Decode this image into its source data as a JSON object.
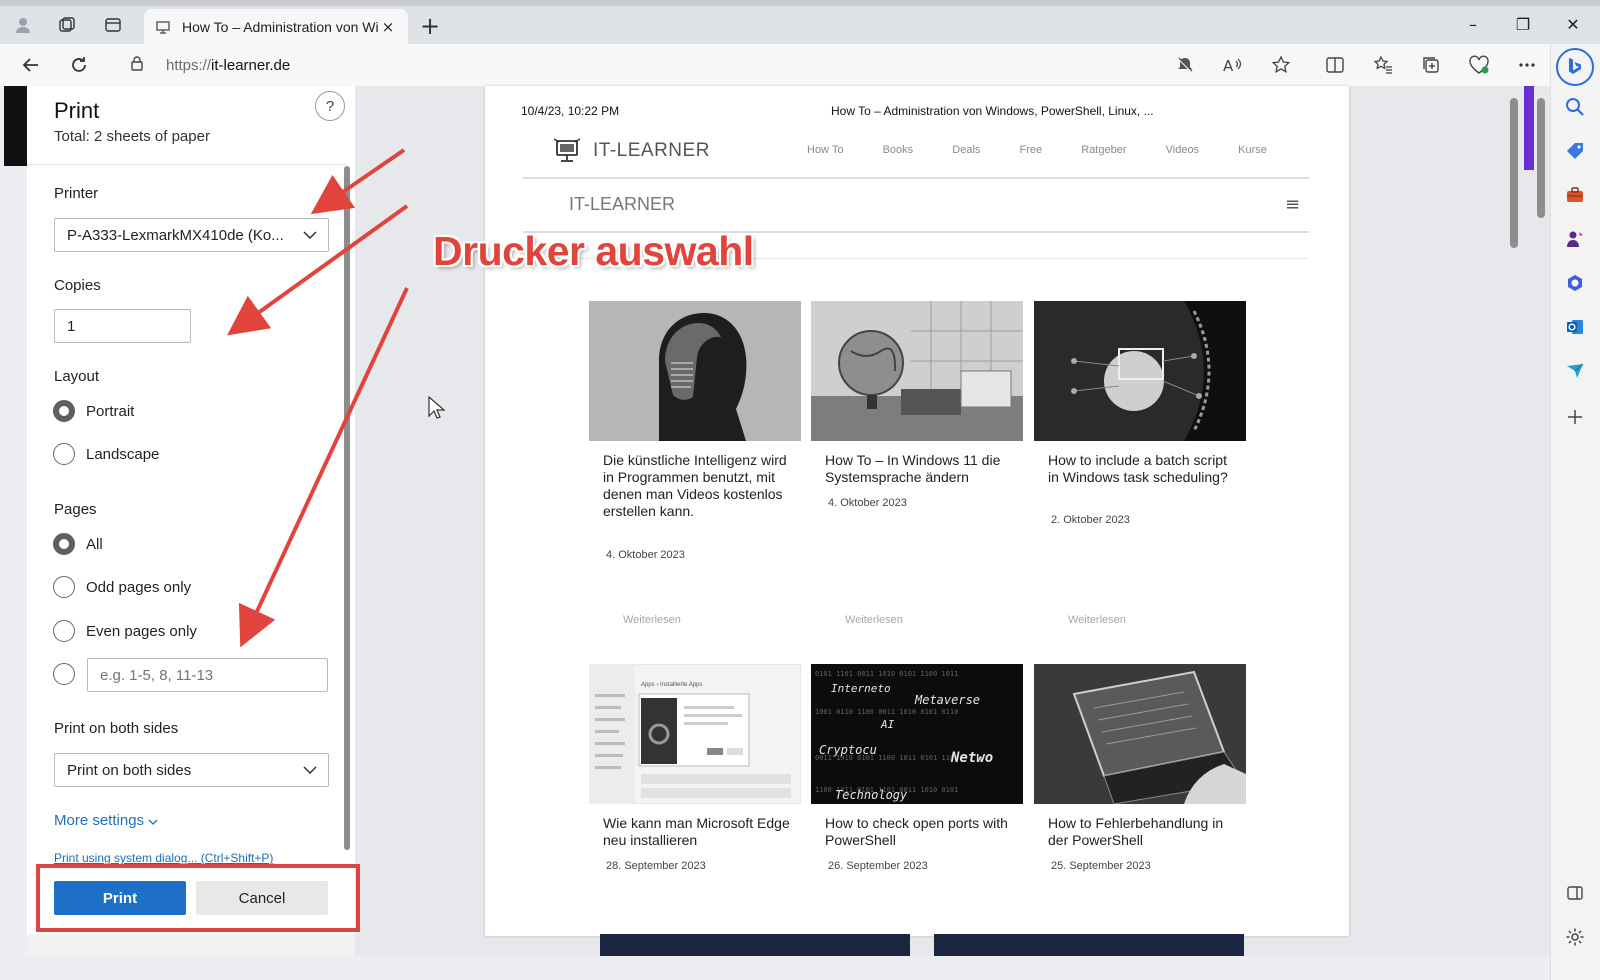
{
  "browser": {
    "tab_title": "How To – Administration von Wi",
    "tab_close": "×",
    "new_tab": "+",
    "url_scheme": "https://",
    "url_host": "it-learner.de",
    "window": {
      "minimize": "–",
      "restore": "❐",
      "close": "✕"
    }
  },
  "print_dialog": {
    "title": "Print",
    "subtitle": "Total: 2 sheets of paper",
    "help": "?",
    "printer_label": "Printer",
    "printer_value": "P-A333-LexmarkMX410de (Ko...",
    "copies_label": "Copies",
    "copies_value": "1",
    "layout_label": "Layout",
    "layout_options": [
      "Portrait",
      "Landscape"
    ],
    "layout_selected": "Portrait",
    "pages_label": "Pages",
    "pages_options": [
      "All",
      "Odd pages only",
      "Even pages only"
    ],
    "pages_selected": "All",
    "pages_custom_placeholder": "e.g. 1-5, 8, 11-13",
    "duplex_label": "Print on both sides",
    "duplex_value": "Print on both sides",
    "more_settings": "More settings",
    "system_dialog_link": "Print using system dialog... (Ctrl+Shift+P)",
    "print_button": "Print",
    "cancel_button": "Cancel"
  },
  "preview": {
    "date": "10/4/23, 10:22 PM",
    "header_title": "How To – Administration von Windows, PowerShell, Linux, ...",
    "logo_text": "IT-LEARNER",
    "nav": [
      "How To",
      "Books",
      "Deals",
      "Free",
      "Ratgeber",
      "Videos",
      "Kurse"
    ],
    "logo_text_2": "IT-LEARNER",
    "menu_icon": "≡",
    "read_more": "Weiterlesen",
    "cards_row1": [
      {
        "title": "Die künstliche Intelligenz wird in Programmen benutzt, mit denen man Videos kostenlos erstellen kann.",
        "date": "4. Oktober 2023"
      },
      {
        "title": "How To – In Windows 11 die Systemsprache ändern",
        "date": "4. Oktober 2023"
      },
      {
        "title": "How to include a batch script in Windows task scheduling?",
        "date": "2. Oktober 2023"
      }
    ],
    "cards_row2": [
      {
        "title": "Wie kann man Microsoft Edge neu installieren",
        "date": "28. September 2023"
      },
      {
        "title": "How to check open ports with PowerShell",
        "date": "26. September 2023"
      },
      {
        "title": "How to Fehlerbehandlung in der PowerShell",
        "date": "25. September 2023"
      }
    ],
    "card_screenshot_text": "Apps › Installierte Apps",
    "card_code_words": [
      "Interneto",
      "Metaverse",
      "AI",
      "Cryptocu",
      "Netwo",
      "Technology"
    ]
  },
  "annotation": {
    "text": "Drucker auswahl",
    "color": "#e0443c"
  },
  "colors": {
    "accent": "#1e6fc6",
    "highlight": "#d94545",
    "link": "#1d6fb8"
  }
}
